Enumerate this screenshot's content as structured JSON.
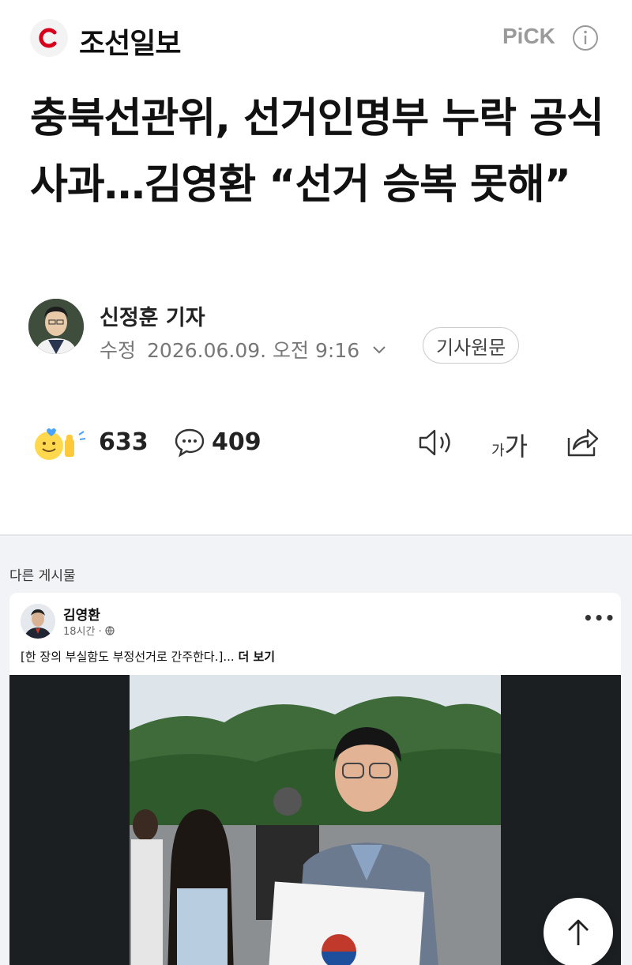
{
  "header": {
    "press_name": "조선일보",
    "pick_label": "PiCK"
  },
  "article": {
    "headline": "충북선관위, 선거인명부 누락 공식 사과…김영환 “선거 승복 못해”",
    "reporter": "신정훈 기자",
    "date_label": "수정",
    "date": "2026.06.09. 오전 9:16",
    "original_button": "기사원문"
  },
  "actions": {
    "like_count": "633",
    "comment_count": "409",
    "font_small": "가",
    "font_large": "가"
  },
  "other_posts": {
    "label": "다른 게시물",
    "post": {
      "author": "김영환",
      "time": "18시간 ·",
      "text": "[한 장의 부실함도 부정선거로 간주한다.]...",
      "more_label": "더 보기",
      "menu": "•••"
    }
  },
  "colors": {
    "brand_red": "#d6001c",
    "pick_gray": "#9a9a9a",
    "gray_bg": "#f1f3f6"
  },
  "icons": [
    "chosun-logo-icon",
    "info-icon",
    "chevron-down-icon",
    "like-emoji-icon",
    "comment-icon",
    "speaker-icon",
    "share-icon",
    "globe-icon",
    "arrow-up-icon"
  ]
}
